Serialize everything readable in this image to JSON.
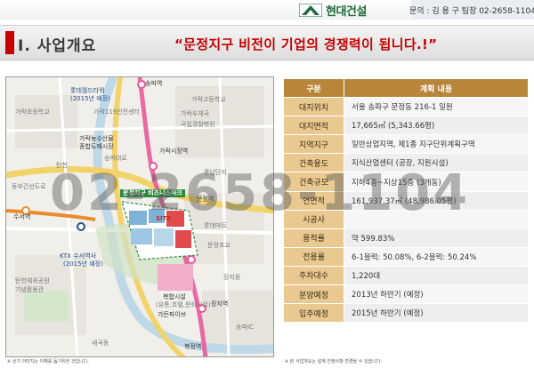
{
  "header": {
    "logo_text": "현대건설",
    "contact": "문의 : 김 용 구 팀장 02-2658-1104"
  },
  "title": {
    "section": "Ⅰ. 사업개요",
    "slogan": "“문정지구 비전이 기업의 경쟁력이 됩니다.!”"
  },
  "map": {
    "labels": {
      "songpa_station": "송파역",
      "lotte_world_tower": "롯데월드타워",
      "lotte_year": "(2015년 예정)",
      "garak_elementary": "가락초등학교",
      "garak_high": "가락고등학교",
      "garak_119": "가락119안전센터",
      "post_office": "가락우체국",
      "national_hospital": "국립경찰병원",
      "garak_market_station": "가락시장역",
      "garak_market": "가락농수산물",
      "garak_market_2": "종합도매시장",
      "tancheon": "탄천",
      "songpa_daero": "송파대로",
      "seoul_dongbu_hwy": "동부간선도로",
      "suseo_station": "수서역",
      "munjeong_station": "문정역",
      "munjeong_business_park": "문정지구 비즈니스파크",
      "site": "SITE",
      "ktx": "KTX 수서역사",
      "ktx_year": "(2015년 예정)",
      "jangji_station": "장지역",
      "complex_facility": "복합시설",
      "complex_note": "(유통,호텔,문화시설)",
      "garden_five": "가든파이브",
      "tancheon_park": "탄천체육공원",
      "park2": "기념활용관",
      "jangji_apt": "장지동",
      "songpa_ic": "송파IC",
      "bokjeong": "복정역",
      "lotte_mart": "롯데마트",
      "munjeong_elem": "문정초교",
      "segok": "세곡동",
      "pungnap": "풍납단지"
    },
    "disclaimer": "※ 상기 이미지는 이해를 돕기위한 것입니다."
  },
  "table": {
    "header_key": "구분",
    "header_value": "계획 내용",
    "rows": [
      {
        "key": "대지위치",
        "value": "서울 송파구 문정동 216-1 일원"
      },
      {
        "key": "대지면적",
        "value": "17,665㎡ (5,343.66평)"
      },
      {
        "key": "지역지구",
        "value": "일반상업지역, 제1종 지구단위계획구역"
      },
      {
        "key": "건축용도",
        "value": "지식산업센터 (공장, 지원시설)"
      },
      {
        "key": "건축규모",
        "value": "지하4층~지상15층 (3개동)"
      },
      {
        "key": "연면적",
        "value": "161,937.37㎡ (48,986.05평)"
      },
      {
        "key": "시공사",
        "value": ""
      },
      {
        "key": "용적률",
        "value": "약 599.83%"
      },
      {
        "key": "전용률",
        "value": "6-1블럭: 50.08%, 6-2블럭: 50.24%"
      },
      {
        "key": "주차대수",
        "value": "1,220대"
      },
      {
        "key": "분양예정",
        "value": "2013년 하반기 (예정)"
      },
      {
        "key": "입주예정",
        "value": "2015년 하반기 (예정)"
      }
    ],
    "disclaimer": "※ 본 사업개요는 설계 진행사항 변경될 수 있습니다."
  },
  "watermark": "02-2658-1104",
  "colors": {
    "brand_green": "#1d6a3a",
    "title_red": "#c40000",
    "table_header": "#b8863b",
    "table_key": "#e9c98f"
  }
}
